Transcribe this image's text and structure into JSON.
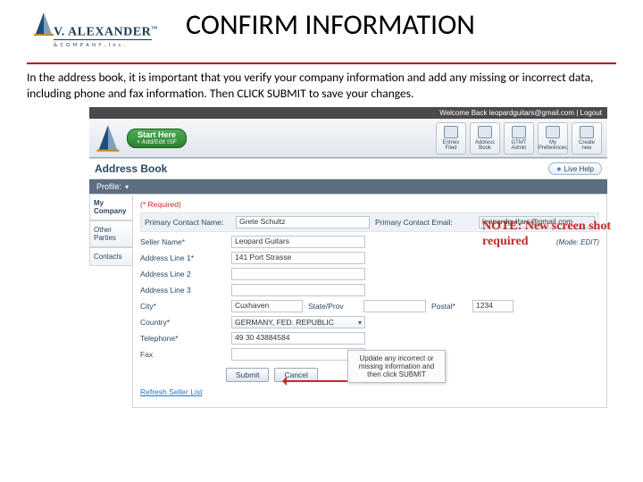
{
  "header": {
    "logo": {
      "brand_line1": "V. ALEXANDER",
      "brand_line2": "& C O M P A N Y ,  I n c .",
      "tm": "™"
    },
    "title": "CONFIRM INFORMATION"
  },
  "intro": "In the address book, it is important that you verify your company information and add any missing or incorrect data, including phone and fax information. Then CLICK SUBMIT to save your changes.",
  "note": "NOTE: New screen shot required",
  "app": {
    "topbar": "Welcome Back leopardguitars@gmail.com | Logout",
    "start_label": "Start Here",
    "start_sub": "+ Add/Edit ISF",
    "toolbar_icons": [
      {
        "label": "Entries Filed"
      },
      {
        "label": "Address Book"
      },
      {
        "label": "GTMT Admin"
      },
      {
        "label": "My Preferences"
      },
      {
        "label": "Create new"
      }
    ],
    "section_title": "Address Book",
    "live_help": "Live Help",
    "profile_label": "Profile:",
    "tabs": {
      "t1": "My Company",
      "t2": "Other Parties",
      "t3": "Contacts"
    },
    "required": "(* Required)",
    "mode": "(Mode: EDIT)",
    "fields": {
      "primary_contact_name_label": "Primary Contact Name:",
      "primary_contact_name_value": "Grete Schultz",
      "primary_contact_email_label": "Primary Contact Email:",
      "primary_contact_email_value": "leopardguitars@gmail.com",
      "seller_name_label": "Seller Name*",
      "seller_name_value": "Leopard Guitars",
      "addr1_label": "Address Line 1*",
      "addr1_value": "141 Port Strasse",
      "addr2_label": "Address Line 2",
      "addr3_label": "Address Line 3",
      "city_label": "City*",
      "city_value": "Cuxhaven",
      "state_label": "State/Prov",
      "postal_label": "Postal*",
      "postal_value": "1234",
      "country_label": "Country*",
      "country_value": "GERMANY, FED. REPUBLIC",
      "phone_label": "Telephone*",
      "phone_value": "49 30 43884584",
      "fax_label": "Fax"
    },
    "buttons": {
      "submit": "Submit",
      "cancel": "Cancel"
    },
    "refresh": "Refresh Seller List",
    "callout": "Update any incorrect or missing information and then click SUBMIT"
  }
}
